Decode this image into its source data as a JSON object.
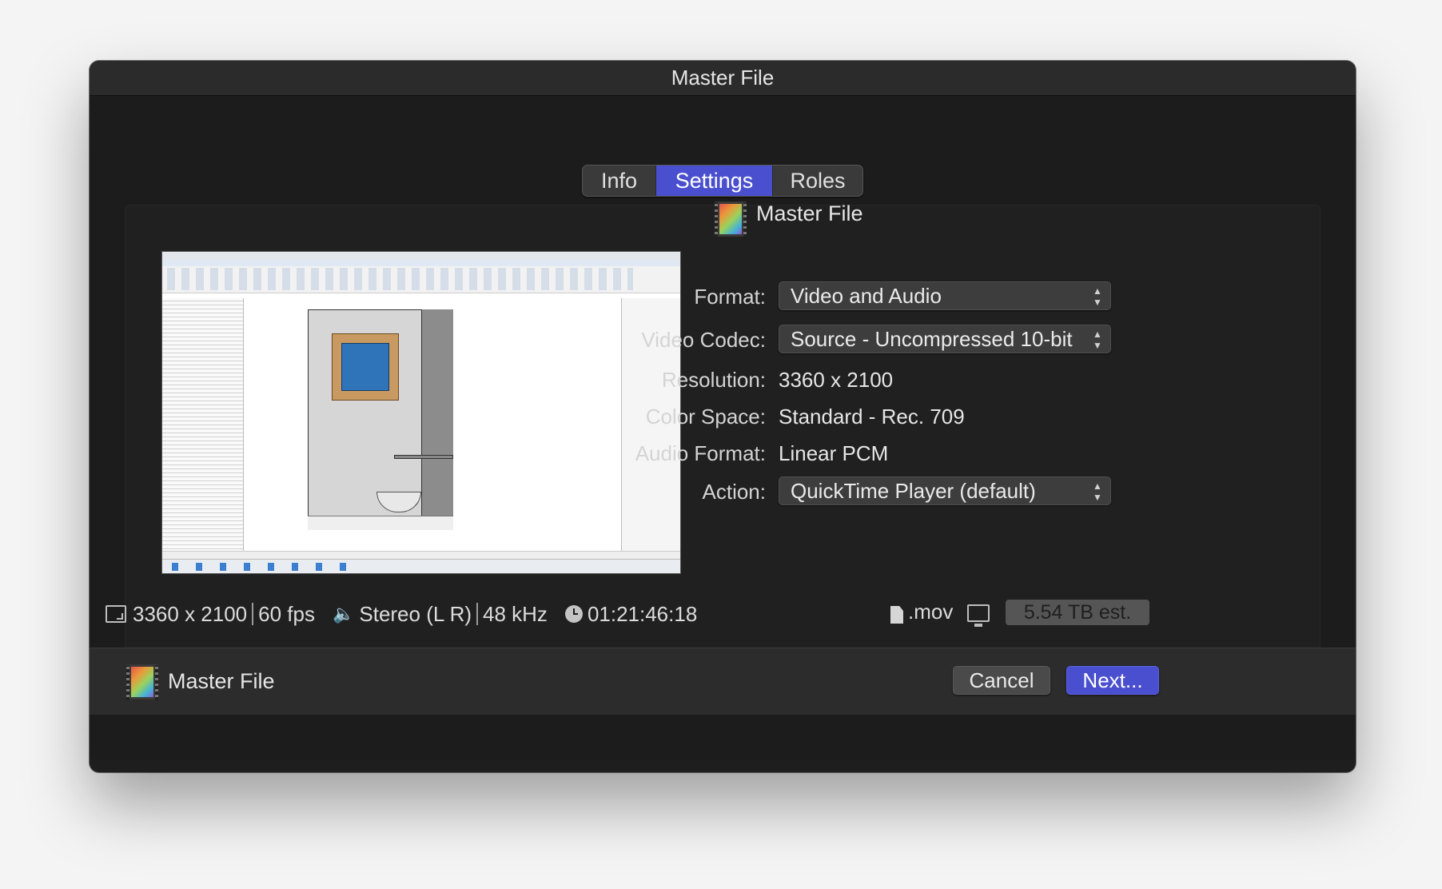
{
  "window": {
    "title": "Master File"
  },
  "tabs": [
    {
      "label": "Info",
      "active": false
    },
    {
      "label": "Settings",
      "active": true
    },
    {
      "label": "Roles",
      "active": false
    }
  ],
  "header": {
    "title": "Master File",
    "icon": "film-icon"
  },
  "settings": {
    "format": {
      "label": "Format:",
      "value": "Video and Audio"
    },
    "video_codec": {
      "label": "Video Codec:",
      "value": "Source - Uncompressed 10-bit 4:..."
    },
    "resolution": {
      "label": "Resolution:",
      "value": "3360 x 2100"
    },
    "color_space": {
      "label": "Color Space:",
      "value": "Standard - Rec. 709"
    },
    "audio_format": {
      "label": "Audio Format:",
      "value": "Linear PCM"
    },
    "action": {
      "label": "Action:",
      "value": "QuickTime Player (default)"
    }
  },
  "status": {
    "resolution": "3360 x 2100",
    "fps": "60 fps",
    "audio_channels": "Stereo (L R)",
    "sample_rate": "48 kHz",
    "duration": "01:21:46:18",
    "extension": ".mov",
    "size_estimate": "5.54 TB est."
  },
  "footer": {
    "title": "Master File",
    "cancel_label": "Cancel",
    "next_label": "Next..."
  },
  "colors": {
    "accent": "#4a4fcf",
    "background": "#1e1e1e"
  }
}
